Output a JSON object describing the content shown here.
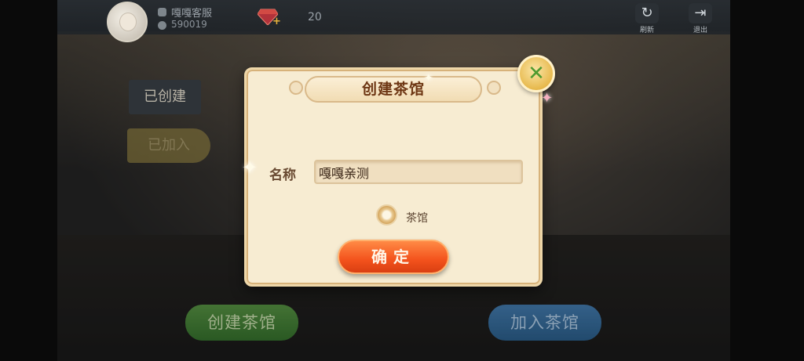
{
  "user": {
    "name": "嘎嘎客服",
    "id": "590019"
  },
  "currency": {
    "gem_count": "20",
    "plus_symbol": "+"
  },
  "toolbar": {
    "refresh_label": "刷新",
    "exit_label": "退出"
  },
  "side_tabs": [
    {
      "label": "已创建"
    },
    {
      "label": "已加入"
    }
  ],
  "bottom_buttons": {
    "create_hall": "创建茶馆",
    "join_hall": "加入茶馆"
  },
  "dialog": {
    "title": "创建茶馆",
    "name_label": "名称",
    "name_value": "嘎嘎亲测",
    "radio_label": "茶馆",
    "confirm_label": "确定"
  },
  "icons": {
    "gem": "diamond-icon",
    "refresh": "refresh-icon",
    "exit": "exit-icon",
    "close": "close-icon"
  },
  "colors": {
    "dialog_bg": "#f7ecd2",
    "confirm": "#f3521c",
    "close_button": "#e7b94d"
  }
}
